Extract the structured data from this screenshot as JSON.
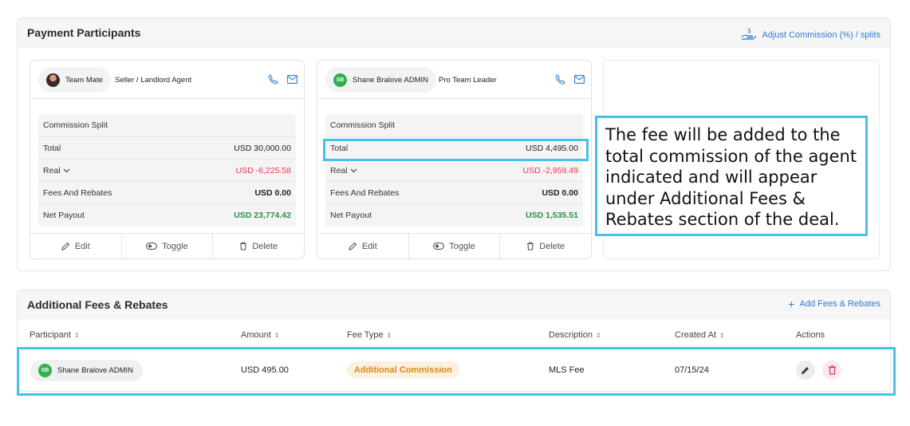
{
  "participants": {
    "title": "Payment Participants",
    "adjust_link": "Adjust Commission (%) / splits",
    "cards": [
      {
        "name": "Team Mate",
        "role": "Seller / Landlord Agent",
        "split_title": "Commission Split",
        "rows": [
          {
            "label": "Total",
            "value": "USD 30,000.00"
          },
          {
            "label": "Real",
            "value": "USD -6,225.58"
          },
          {
            "label": "Fees And Rebates",
            "value": "USD 0.00"
          },
          {
            "label": "Net Payout",
            "value": "USD 23,774.42"
          }
        ],
        "actions": {
          "edit": "Edit",
          "toggle": "Toggle",
          "delete": "Delete"
        }
      },
      {
        "name": "Shane Bralove ADMIN",
        "initials": "SB",
        "role": "Pro Team Leader",
        "split_title": "Commission Split",
        "rows": [
          {
            "label": "Total",
            "value": "USD 4,495.00"
          },
          {
            "label": "Real",
            "value": "USD -2,959.49"
          },
          {
            "label": "Fees And Rebates",
            "value": "USD 0.00"
          },
          {
            "label": "Net Payout",
            "value": "USD 1,535.51"
          }
        ],
        "actions": {
          "edit": "Edit",
          "toggle": "Toggle",
          "delete": "Delete"
        }
      }
    ]
  },
  "callout": {
    "text": "The fee will be added to the total commission of the agent indicated and will appear under Additional Fees & Rebates section of the deal."
  },
  "fees": {
    "title": "Additional Fees & Rebates",
    "add_link": "Add Fees & Rebates",
    "columns": [
      "Participant",
      "Amount",
      "Fee Type",
      "Description",
      "Created At",
      "Actions"
    ],
    "row": {
      "initials": "SB",
      "participant": "Shane Bralove ADMIN",
      "amount": "USD 495.00",
      "fee_type": "Additional Commission",
      "description": "MLS Fee",
      "created_at": "07/15/24"
    }
  },
  "colors": {
    "accent": "#2f7bd6",
    "highlight": "#46c1e8",
    "negative": "#e23a55",
    "positive": "#2d8c4e",
    "avatar_green": "#2fb14a",
    "badge_text": "#d68a1b"
  }
}
